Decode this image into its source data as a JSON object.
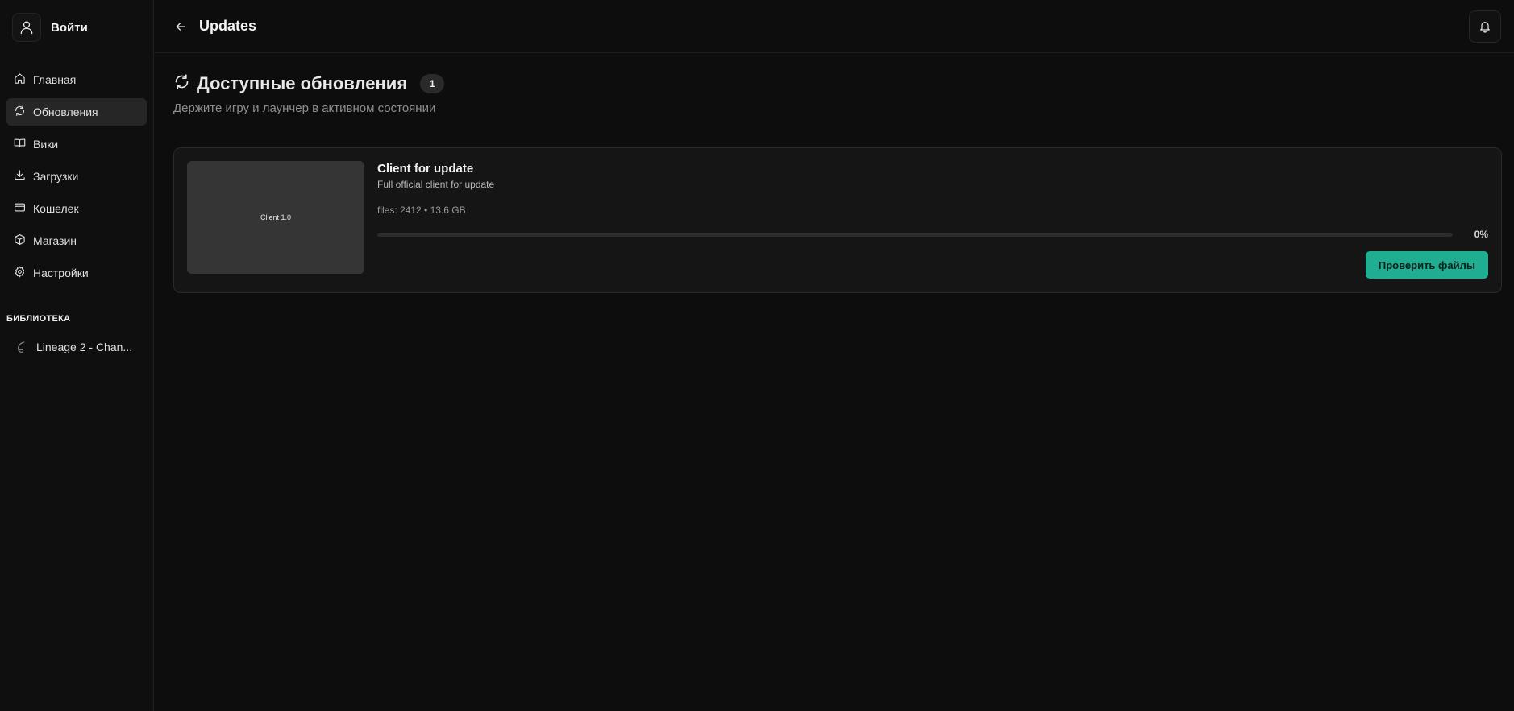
{
  "sidebar": {
    "login_label": "Войти",
    "nav": [
      {
        "label": "Главная",
        "icon": "home-icon"
      },
      {
        "label": "Обновления",
        "icon": "refresh-icon",
        "active": true
      },
      {
        "label": "Вики",
        "icon": "book-icon"
      },
      {
        "label": "Загрузки",
        "icon": "download-icon"
      },
      {
        "label": "Кошелек",
        "icon": "wallet-icon"
      },
      {
        "label": "Магазин",
        "icon": "box-icon"
      },
      {
        "label": "Настройки",
        "icon": "gear-icon"
      }
    ],
    "library_title": "БИБЛИОТЕКА",
    "library": [
      {
        "label": "Lineage 2 - Chan...",
        "icon": "game-icon"
      }
    ]
  },
  "header": {
    "title": "Updates"
  },
  "section": {
    "title": "Доступные обновления",
    "count": "1",
    "subtitle": "Держите игру и лаунчер в активном состоянии"
  },
  "updates": [
    {
      "thumb_label": "Client 1.0",
      "title": "Client for update",
      "description": "Full official client for update",
      "meta": "files: 2412 • 13.6 GB",
      "progress": 0,
      "progress_text": "0%",
      "action_label": "Проверить файлы"
    }
  ],
  "colors": {
    "accent": "#1fae92",
    "background": "#0d0d0d",
    "card": "#151515"
  }
}
